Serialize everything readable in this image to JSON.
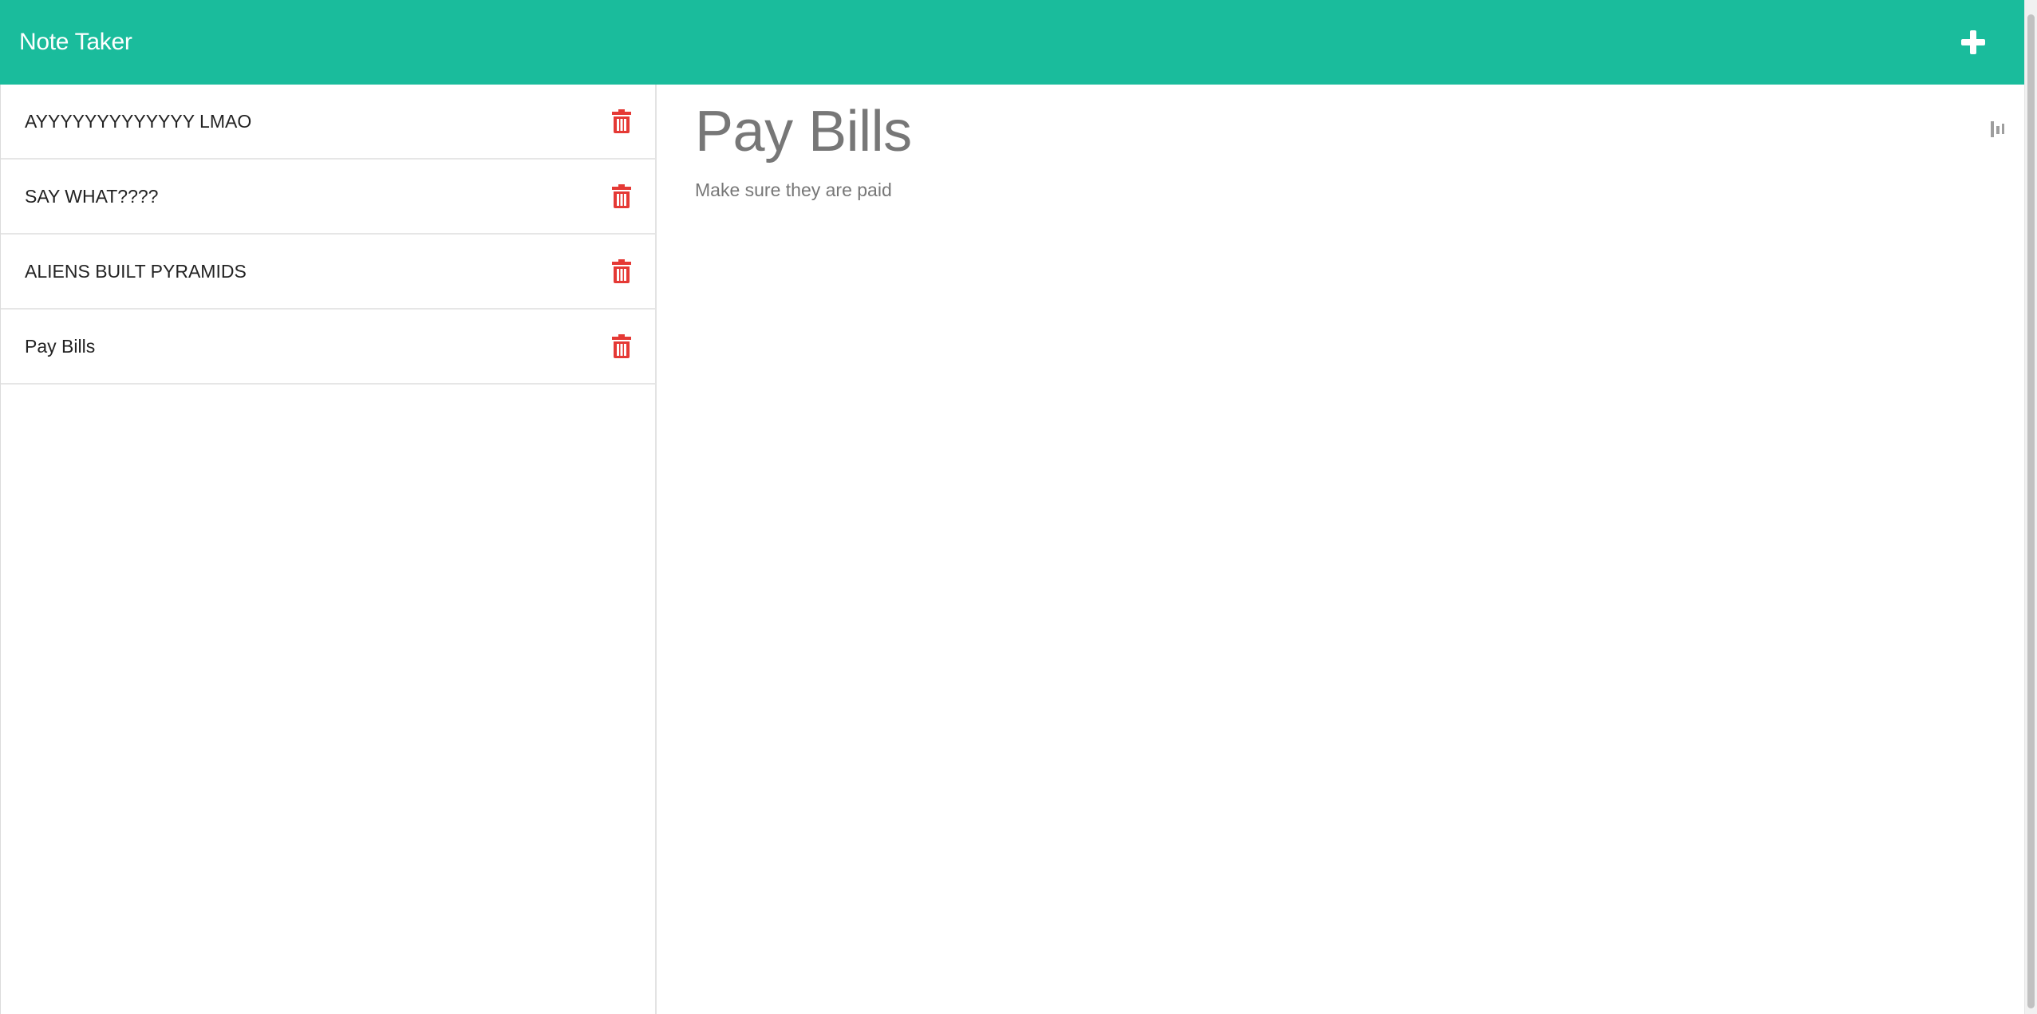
{
  "navbar": {
    "brand": "Note Taker",
    "new_note_icon": "plus-icon"
  },
  "notes": [
    {
      "title": "AYYYYYYYYYYYYY LMAO",
      "delete_icon": "trash-icon"
    },
    {
      "title": "SAY WHAT????",
      "delete_icon": "trash-icon"
    },
    {
      "title": "ALIENS BUILT PYRAMIDS",
      "delete_icon": "trash-icon"
    },
    {
      "title": "Pay Bills",
      "delete_icon": "trash-icon"
    }
  ],
  "active_note": {
    "title": "Pay Bills",
    "text": "Make sure they are paid"
  },
  "colors": {
    "navbar_bg": "#1abc9c",
    "delete_icon": "#e53935",
    "muted_text": "#777777"
  }
}
